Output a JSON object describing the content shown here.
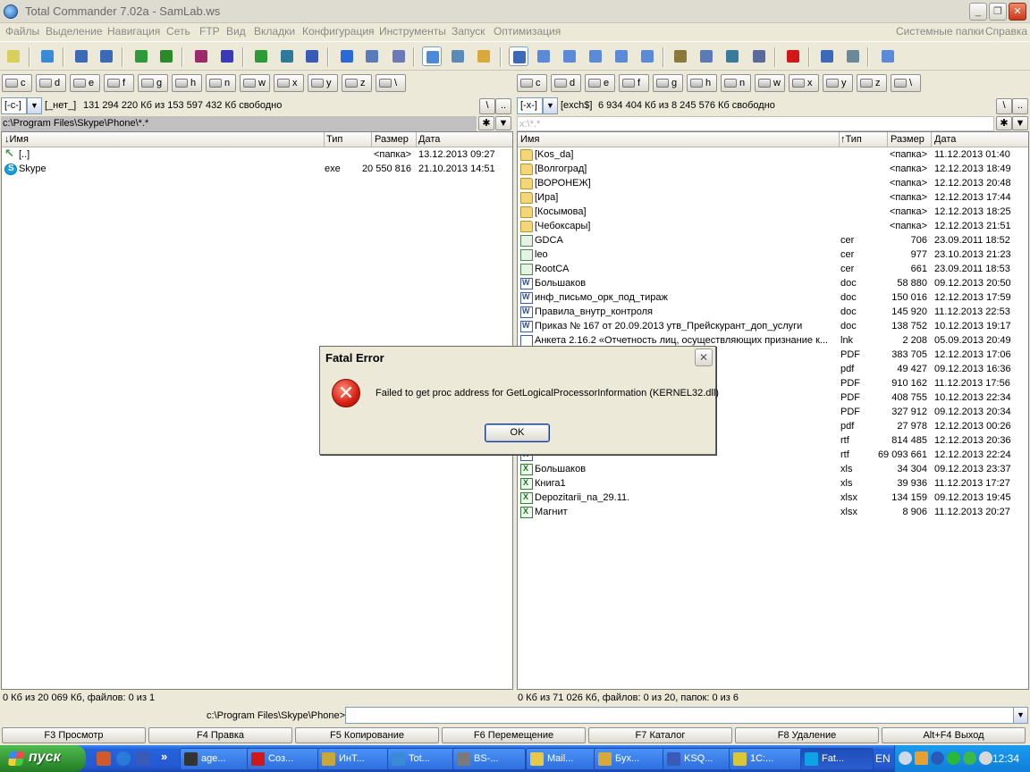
{
  "window": {
    "title": "Total Commander 7.02a - SamLab.ws"
  },
  "menu": [
    "Файлы",
    "Выделение",
    "Навигация",
    "Сеть",
    "FTP",
    "Вид",
    "Вкладки",
    "Конфигурация",
    "Инструменты",
    "Запуск",
    "Оптимизация",
    "Системные папки",
    "Справка"
  ],
  "toolbar_icons": [
    {
      "name": "bulb-icon",
      "color": "#d7d05a"
    },
    {
      "name": "refresh-icon",
      "color": "#3a8ad8"
    },
    {
      "name": "back-icon",
      "color": "#3a6ab8"
    },
    {
      "name": "forward-icon",
      "color": "#3a6ab8"
    },
    {
      "name": "network-icon",
      "color": "#2e9a3a"
    },
    {
      "name": "package-icon",
      "color": "#2a8a2a"
    },
    {
      "name": "archive-icon",
      "color": "#9a2a6a"
    },
    {
      "name": "unpack-icon",
      "color": "#3a3ab8"
    },
    {
      "name": "sort-icon",
      "color": "#2e9a3a"
    },
    {
      "name": "sort-az-icon",
      "color": "#2e7a9a"
    },
    {
      "name": "select-icon",
      "color": "#3a5ab8"
    },
    {
      "name": "browser-icon",
      "color": "#2a6ad8"
    },
    {
      "name": "ftp-icon",
      "color": "#5a7ab8"
    },
    {
      "name": "notepad-icon",
      "color": "#6a7ab8"
    },
    {
      "name": "pin-icon",
      "color": "#4a8ad8"
    },
    {
      "name": "search-icon",
      "color": "#5a8ab8"
    },
    {
      "name": "view-icon",
      "color": "#d8a83a"
    },
    {
      "name": "panel-icon",
      "color": "#3a6ab8"
    },
    {
      "name": "folder-new-icon",
      "color": "#5a8ad8"
    },
    {
      "name": "folder-copy-icon",
      "color": "#5a8ad8"
    },
    {
      "name": "folder-move-icon",
      "color": "#5a8ad8"
    },
    {
      "name": "folder-up-icon",
      "color": "#5a8ad8"
    },
    {
      "name": "folder-sync-icon",
      "color": "#5a8ad8"
    },
    {
      "name": "tools-icon",
      "color": "#8a7a3a"
    },
    {
      "name": "find-icon",
      "color": "#5a7ab8"
    },
    {
      "name": "grid-icon",
      "color": "#3a7a9a"
    },
    {
      "name": "settings-icon",
      "color": "#5a6a9a"
    },
    {
      "name": "delete-icon",
      "color": "#d01818"
    },
    {
      "name": "edit-icon",
      "color": "#3a6ab8"
    },
    {
      "name": "config-icon",
      "color": "#6a8a9a"
    },
    {
      "name": "globe-icon",
      "color": "#5a8ad8"
    }
  ],
  "drives": [
    "c",
    "d",
    "e",
    "f",
    "g",
    "h",
    "n",
    "w",
    "x",
    "y",
    "z",
    "\\"
  ],
  "left": {
    "drive": "[-c-]",
    "label": "[_нет_]",
    "free": "131 294 220 Кб из 153 597 432 Кб свободно",
    "path": "c:\\Program Files\\Skype\\Phone\\*.*",
    "headers": {
      "name": "↓Имя",
      "type": "Тип",
      "size": "Размер",
      "date": "Дата"
    },
    "rows": [
      {
        "icon": "up",
        "name": "[..]",
        "type": "",
        "size": "<папка>",
        "date": "13.12.2013 09:27"
      },
      {
        "icon": "skype",
        "name": "Skype",
        "type": "exe",
        "size": "20 550 816",
        "date": "21.10.2013 14:51"
      }
    ],
    "status": "0 Кб из 20 069 Кб, файлов: 0 из 1"
  },
  "right": {
    "drive": "[-x-]",
    "label": "[exch$]",
    "free": "6 934 404 Кб из 8 245 576 Кб свободно",
    "path": "x:\\*.*",
    "headers": {
      "name": "Имя",
      "type": "↑Тип",
      "size": "Размер",
      "date": "Дата"
    },
    "rows": [
      {
        "icon": "folder",
        "name": "[Kos_da]",
        "type": "",
        "size": "<папка>",
        "date": "11.12.2013 01:40"
      },
      {
        "icon": "folder",
        "name": "[Волгоград]",
        "type": "",
        "size": "<папка>",
        "date": "12.12.2013 18:49"
      },
      {
        "icon": "folder",
        "name": "[ВОРОНЕЖ]",
        "type": "",
        "size": "<папка>",
        "date": "12.12.2013 20:48"
      },
      {
        "icon": "folder",
        "name": "[Ира]",
        "type": "",
        "size": "<папка>",
        "date": "12.12.2013 17:44"
      },
      {
        "icon": "folder",
        "name": "[Косымова]",
        "type": "",
        "size": "<папка>",
        "date": "12.12.2013 18:25"
      },
      {
        "icon": "folder",
        "name": "[Чебоксары]",
        "type": "",
        "size": "<папка>",
        "date": "12.12.2013 21:51"
      },
      {
        "icon": "cert",
        "name": "GDCA",
        "type": "cer",
        "size": "706",
        "date": "23.09.2011 18:52"
      },
      {
        "icon": "cert",
        "name": "leo",
        "type": "cer",
        "size": "977",
        "date": "23.10.2013 21:23"
      },
      {
        "icon": "cert",
        "name": "RootCA",
        "type": "cer",
        "size": "661",
        "date": "23.09.2011 18:53"
      },
      {
        "icon": "doc",
        "name": "Большаков",
        "type": "doc",
        "size": "58 880",
        "date": "09.12.2013 20:50"
      },
      {
        "icon": "doc",
        "name": "инф_письмо_орк_под_тираж",
        "type": "doc",
        "size": "150 016",
        "date": "12.12.2013 17:59"
      },
      {
        "icon": "doc",
        "name": "Правила_внутр_контроля",
        "type": "doc",
        "size": "145 920",
        "date": "11.12.2013 22:53"
      },
      {
        "icon": "doc",
        "name": "Приказ № 167 от 20.09.2013 утв_Прейскурант_доп_услуги",
        "type": "doc",
        "size": "138 752",
        "date": "10.12.2013 19:17"
      },
      {
        "icon": "lnk",
        "name": "Анкета 2.16.2 «Отчетность лиц, осуществляющих признание к...",
        "type": "lnk",
        "size": "2 208",
        "date": "05.09.2013 20:49"
      },
      {
        "icon": "doc",
        "name": "",
        "type": "PDF",
        "size": "383 705",
        "date": "12.12.2013 17:06"
      },
      {
        "icon": "doc",
        "name": "",
        "type": "pdf",
        "size": "49 427",
        "date": "09.12.2013 16:36"
      },
      {
        "icon": "doc",
        "name": "",
        "type": "PDF",
        "size": "910 162",
        "date": "11.12.2013 17:56"
      },
      {
        "icon": "doc",
        "name": "",
        "type": "PDF",
        "size": "408 755",
        "date": "10.12.2013 22:34"
      },
      {
        "icon": "doc",
        "name": "",
        "type": "PDF",
        "size": "327 912",
        "date": "09.12.2013 20:34"
      },
      {
        "icon": "doc",
        "name": "",
        "type": "pdf",
        "size": "27 978",
        "date": "12.12.2013 00:26"
      },
      {
        "icon": "doc",
        "name": "",
        "type": "rtf",
        "size": "814 485",
        "date": "12.12.2013 20:36"
      },
      {
        "icon": "doc",
        "name": "",
        "type": "rtf",
        "size": "69 093 661",
        "date": "12.12.2013 22:24"
      },
      {
        "icon": "xls",
        "name": "Большаков",
        "type": "xls",
        "size": "34 304",
        "date": "09.12.2013 23:37"
      },
      {
        "icon": "xls",
        "name": "Книга1",
        "type": "xls",
        "size": "39 936",
        "date": "11.12.2013 17:27"
      },
      {
        "icon": "xls",
        "name": "Depozitarii_na_29.11.",
        "type": "xlsx",
        "size": "134 159",
        "date": "09.12.2013 19:45"
      },
      {
        "icon": "xls",
        "name": "Магнит",
        "type": "xlsx",
        "size": "8 906",
        "date": "11.12.2013 20:27"
      }
    ],
    "status": "0 Кб из 71 026 Кб, файлов: 0 из 20, папок: 0 из 6"
  },
  "cmd": {
    "label": "c:\\Program Files\\Skype\\Phone>",
    "value": ""
  },
  "fkeys": [
    "F3 Просмотр",
    "F4 Правка",
    "F5 Копирование",
    "F6 Перемещение",
    "F7 Каталог",
    "F8 Удаление",
    "Alt+F4 Выход"
  ],
  "dialog": {
    "title": "Fatal Error",
    "message": "Failed to get proc address for GetLogicalProcessorInformation (KERNEL32.dll)",
    "ok": "OK",
    "close": "✕"
  },
  "taskbar": {
    "start": "пуск",
    "tasks": [
      {
        "label": "age...",
        "color": "#333333"
      },
      {
        "label": "Соз...",
        "color": "#d01818"
      },
      {
        "label": "ИнТ...",
        "color": "#c8a838"
      },
      {
        "label": "Tot...",
        "color": "#3a8ad8"
      },
      {
        "label": "BS-...",
        "color": "#7a7a7a"
      },
      {
        "label": "Mail...",
        "color": "#e8c848"
      },
      {
        "label": "Бух...",
        "color": "#d8a838"
      },
      {
        "label": "KSQ...",
        "color": "#3a5ab8"
      },
      {
        "label": "1С:...",
        "color": "#d8c838"
      },
      {
        "label": "Fat...",
        "color": "#11a2e6"
      }
    ],
    "lang": "EN",
    "clock": "12:34"
  }
}
